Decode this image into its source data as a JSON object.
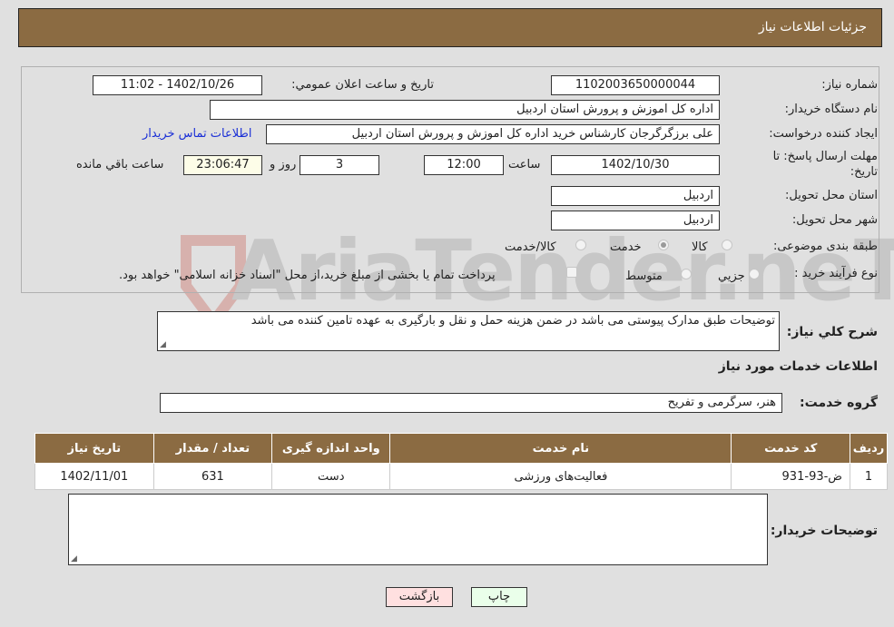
{
  "header": {
    "title": "جزئیات اطلاعات نیاز"
  },
  "form": {
    "need_number_label": "شماره نیاز:",
    "need_number": "1102003650000044",
    "announce_label": "تاريخ و ساعت اعلان عمومي:",
    "announce_value": "1402/10/26 - 11:02",
    "buyer_org_label": "نام دستگاه خريدار:",
    "buyer_org": "اداره کل اموزش و پرورش استان اردبیل",
    "creator_label": "ايجاد کننده درخواست:",
    "creator": "علی برزگرگرجان کارشناس خرید اداره کل اموزش و پرورش استان اردبیل",
    "contact_link": "اطلاعات تماس خريدار",
    "deadline_label_1": "مهلت ارسال پاسخ: تا",
    "deadline_label_2": "تاريخ:",
    "deadline_date": "1402/10/30",
    "time_label": "ساعت",
    "deadline_time": "12:00",
    "days_value": "3",
    "days_label": "روز و",
    "remaining_time": "23:06:47",
    "remaining_label": "ساعت باقي مانده",
    "province_label": "استان محل تحويل:",
    "province": "اردبیل",
    "city_label": "شهر محل تحويل:",
    "city": "اردبیل",
    "category_label": "طبقه بندی موضوعی:",
    "category_options": [
      {
        "label": "کالا",
        "selected": false
      },
      {
        "label": "خدمت",
        "selected": true
      },
      {
        "label": "کالا/خدمت",
        "selected": false
      }
    ],
    "process_label": "نوع فرآيند خريد :",
    "process_options": [
      {
        "label": "جزيي",
        "selected": false
      },
      {
        "label": "متوسط",
        "selected": false
      }
    ],
    "payment_note": "پرداخت تمام یا بخشی از مبلغ خرید،از محل \"اسناد خزانه اسلامی\" خواهد بود.",
    "payment_checked": false
  },
  "description": {
    "label": "شرح کلي نياز:",
    "value": "توضیحات طبق مدارک پیوستی می باشد در ضمن هزینه حمل و نقل و بارگیری به عهده تامین کننده می باشد"
  },
  "services": {
    "section_title": "اطلاعات خدمات مورد نياز",
    "group_label": "گروه خدمت:",
    "group_value": "هنر، سرگرمی و تفریح",
    "table": {
      "headers": [
        "رديف",
        "کد خدمت",
        "نام خدمت",
        "واحد اندازه گيری",
        "تعداد / مقدار",
        "تاريخ نياز"
      ],
      "rows": [
        [
          "1",
          "ض-93-931",
          "فعالیت‌های ورزشی",
          "دست",
          "631",
          "1402/11/01"
        ]
      ]
    }
  },
  "buyer_notes": {
    "label": "توضيحات خريدار:",
    "value": ""
  },
  "buttons": {
    "print": "چاپ",
    "back": "بازگشت"
  },
  "watermark": {
    "text": "AriaTender.neT"
  },
  "colors": {
    "header_bg": "#8b6b42",
    "print_btn": "#eaffea",
    "back_btn": "#ffe0e0",
    "link": "#1a2fd6"
  }
}
